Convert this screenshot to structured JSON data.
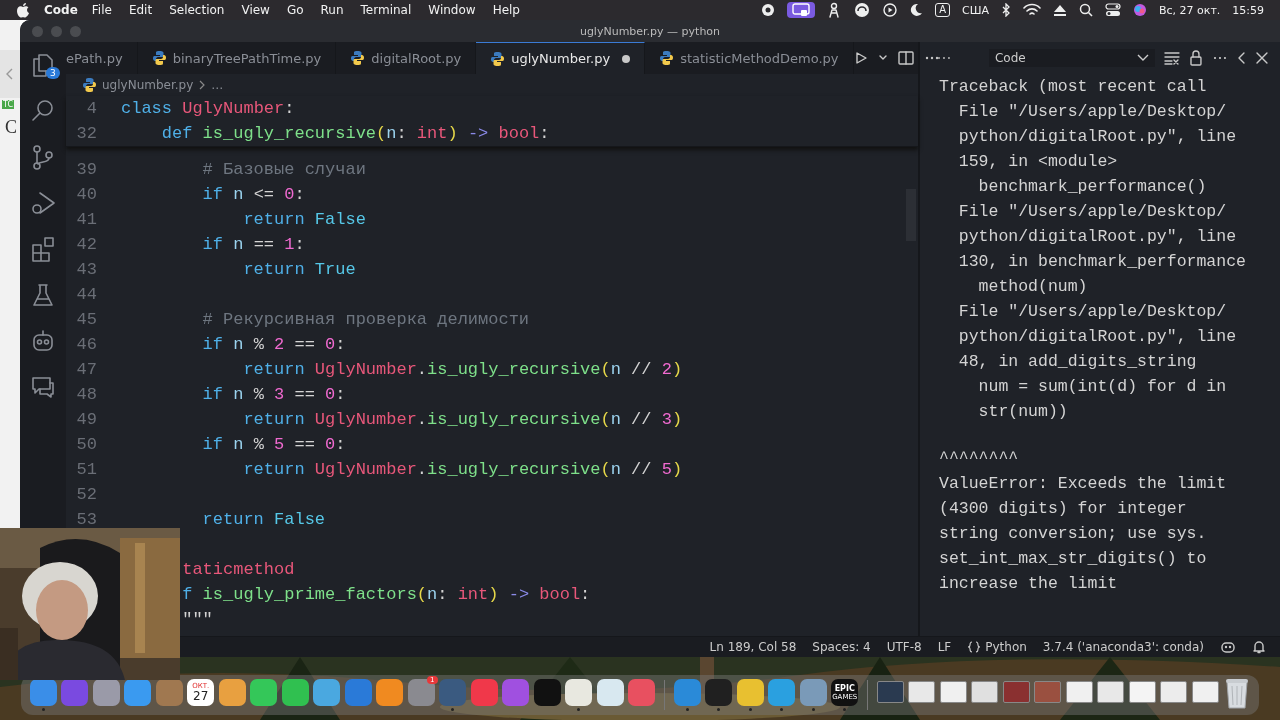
{
  "menu_bar": {
    "app_name": "Code",
    "items": [
      "File",
      "Edit",
      "Selection",
      "View",
      "Go",
      "Run",
      "Terminal",
      "Window",
      "Help"
    ],
    "input_source": "А",
    "keyboard_layout": "США",
    "date": "Вс, 27 окт.",
    "time": "15:59"
  },
  "background_window": {
    "tag": "TC",
    "letter": "C"
  },
  "window": {
    "title": "uglyNumber.py — python"
  },
  "activity_bar": {
    "explorer_badge": "3"
  },
  "tabs": [
    {
      "label": "ePath.py",
      "selected": false,
      "modified": false,
      "python_icon": false
    },
    {
      "label": "binaryTreePathTime.py",
      "selected": false,
      "modified": false,
      "python_icon": true
    },
    {
      "label": "digitalRoot.py",
      "selected": false,
      "modified": false,
      "python_icon": true
    },
    {
      "label": "uglyNumber.py",
      "selected": true,
      "modified": true,
      "python_icon": true
    },
    {
      "label": "statisticMethodDemo.py",
      "selected": false,
      "modified": false,
      "python_icon": true
    }
  ],
  "breadcrumbs": [
    "uglyNumber.py",
    "…"
  ],
  "sticky_lines": [
    {
      "number": "4",
      "tokens": [
        {
          "kind": "kw",
          "text": "class"
        },
        {
          "kind": "cls",
          "text": " UglyNumber"
        },
        {
          "kind": "op",
          "text": ":"
        }
      ]
    },
    {
      "number": "32",
      "tokens": [
        {
          "kind": "kw",
          "text": "    def"
        },
        {
          "kind": "fn",
          "text": " is_ugly_recursive"
        },
        {
          "kind": "paren",
          "text": "("
        },
        {
          "kind": "var",
          "text": "n"
        },
        {
          "kind": "op",
          "text": ":"
        },
        {
          "kind": "type",
          "text": " int"
        },
        {
          "kind": "paren",
          "text": ")"
        },
        {
          "kind": "arrow",
          "text": " ->"
        },
        {
          "kind": "type",
          "text": " bool"
        },
        {
          "kind": "op",
          "text": ":"
        }
      ]
    }
  ],
  "code_lines": [
    {
      "number": "39",
      "tokens": [
        {
          "kind": "cm",
          "text": "        # Базовые случаи"
        }
      ]
    },
    {
      "number": "40",
      "tokens": [
        {
          "kind": "kw",
          "text": "        if"
        },
        {
          "kind": "var",
          "text": " n"
        },
        {
          "kind": "op",
          "text": " <="
        },
        {
          "kind": "num",
          "text": " 0"
        },
        {
          "kind": "op",
          "text": ":"
        }
      ]
    },
    {
      "number": "41",
      "tokens": [
        {
          "kind": "kw",
          "text": "            return"
        },
        {
          "kind": "const",
          "text": " False"
        }
      ]
    },
    {
      "number": "42",
      "tokens": [
        {
          "kind": "kw",
          "text": "        if"
        },
        {
          "kind": "var",
          "text": " n"
        },
        {
          "kind": "op",
          "text": " =="
        },
        {
          "kind": "num",
          "text": " 1"
        },
        {
          "kind": "op",
          "text": ":"
        }
      ]
    },
    {
      "number": "43",
      "tokens": [
        {
          "kind": "kw",
          "text": "            return"
        },
        {
          "kind": "const",
          "text": " True"
        }
      ]
    },
    {
      "number": "44"
    },
    {
      "number": "45",
      "tokens": [
        {
          "kind": "cm",
          "text": "        # Рекурсивная проверка делимости"
        }
      ]
    },
    {
      "number": "46",
      "tokens": [
        {
          "kind": "kw",
          "text": "        if"
        },
        {
          "kind": "var",
          "text": " n"
        },
        {
          "kind": "op",
          "text": " %"
        },
        {
          "kind": "num",
          "text": " 2"
        },
        {
          "kind": "op",
          "text": " =="
        },
        {
          "kind": "num",
          "text": " 0"
        },
        {
          "kind": "op",
          "text": ":"
        }
      ]
    },
    {
      "number": "47",
      "tokens": [
        {
          "kind": "kw",
          "text": "            return"
        },
        {
          "kind": "cls",
          "text": " UglyNumber"
        },
        {
          "kind": "op",
          "text": "."
        },
        {
          "kind": "fn",
          "text": "is_ugly_recursive"
        },
        {
          "kind": "paren",
          "text": "("
        },
        {
          "kind": "var",
          "text": "n"
        },
        {
          "kind": "op",
          "text": " //"
        },
        {
          "kind": "num",
          "text": " 2"
        },
        {
          "kind": "paren",
          "text": ")"
        }
      ]
    },
    {
      "number": "48",
      "tokens": [
        {
          "kind": "kw",
          "text": "        if"
        },
        {
          "kind": "var",
          "text": " n"
        },
        {
          "kind": "op",
          "text": " %"
        },
        {
          "kind": "num",
          "text": " 3"
        },
        {
          "kind": "op",
          "text": " =="
        },
        {
          "kind": "num",
          "text": " 0"
        },
        {
          "kind": "op",
          "text": ":"
        }
      ]
    },
    {
      "number": "49",
      "tokens": [
        {
          "kind": "kw",
          "text": "            return"
        },
        {
          "kind": "cls",
          "text": " UglyNumber"
        },
        {
          "kind": "op",
          "text": "."
        },
        {
          "kind": "fn",
          "text": "is_ugly_recursive"
        },
        {
          "kind": "paren",
          "text": "("
        },
        {
          "kind": "var",
          "text": "n"
        },
        {
          "kind": "op",
          "text": " //"
        },
        {
          "kind": "num",
          "text": " 3"
        },
        {
          "kind": "paren",
          "text": ")"
        }
      ]
    },
    {
      "number": "50",
      "tokens": [
        {
          "kind": "kw",
          "text": "        if"
        },
        {
          "kind": "var",
          "text": " n"
        },
        {
          "kind": "op",
          "text": " %"
        },
        {
          "kind": "num",
          "text": " 5"
        },
        {
          "kind": "op",
          "text": " =="
        },
        {
          "kind": "num",
          "text": " 0"
        },
        {
          "kind": "op",
          "text": ":"
        }
      ]
    },
    {
      "number": "51",
      "tokens": [
        {
          "kind": "kw",
          "text": "            return"
        },
        {
          "kind": "cls",
          "text": " UglyNumber"
        },
        {
          "kind": "op",
          "text": "."
        },
        {
          "kind": "fn",
          "text": "is_ugly_recursive"
        },
        {
          "kind": "paren",
          "text": "("
        },
        {
          "kind": "var",
          "text": "n"
        },
        {
          "kind": "op",
          "text": " //"
        },
        {
          "kind": "num",
          "text": " 5"
        },
        {
          "kind": "paren",
          "text": ")"
        }
      ]
    },
    {
      "number": "52"
    },
    {
      "number": "53",
      "tokens": [
        {
          "kind": "kw",
          "text": "        return"
        },
        {
          "kind": "const",
          "text": " False"
        }
      ]
    },
    {
      "tokens": [
        {
          "kind": "dec",
          "text": "      taticmethod"
        }
      ]
    },
    {
      "tokens": [
        {
          "kind": "kw",
          "text": "      f"
        },
        {
          "kind": "fn",
          "text": " is_ugly_prime_factors"
        },
        {
          "kind": "paren",
          "text": "("
        },
        {
          "kind": "var",
          "text": "n"
        },
        {
          "kind": "op",
          "text": ":"
        },
        {
          "kind": "type",
          "text": " int"
        },
        {
          "kind": "paren",
          "text": ")"
        },
        {
          "kind": "arrow",
          "text": " ->"
        },
        {
          "kind": "type",
          "text": " bool"
        },
        {
          "kind": "op",
          "text": ":"
        }
      ]
    },
    {
      "tokens": [
        {
          "kind": "str",
          "text": "      \"\"\""
        }
      ]
    }
  ],
  "output": {
    "channel": "Code",
    "blocks": [
      [
        "Traceback (most recent call",
        "  File \"/Users/apple/Desktop/",
        "  python/digitalRoot.py\", line",
        "  159, in <module>",
        "    benchmark_performance()",
        "  File \"/Users/apple/Desktop/",
        "  python/digitalRoot.py\", line",
        "  130, in benchmark_performance",
        "    method(num)",
        "  File \"/Users/apple/Desktop/",
        "  python/digitalRoot.py\", line",
        "  48, in add_digits_string",
        "    num = sum(int(d) for d in",
        "    str(num))"
      ],
      [
        "^^^^^^^^",
        "ValueError: Exceeds the limit",
        "(4300 digits) for integer",
        "string conversion; use sys.",
        "set_int_max_str_digits() to",
        "increase the limit"
      ]
    ]
  },
  "status_bar": {
    "position": "Ln 189, Col 58",
    "indentation": "Spaces: 4",
    "encoding": "UTF-8",
    "line_ending": "LF",
    "language": "Python",
    "interpreter": "3.7.4 ('anaconda3': conda)"
  },
  "dock": {
    "items": [
      {
        "kind": "app",
        "color": "#3a8ee8",
        "running": true
      },
      {
        "kind": "app",
        "color": "#7a4ae0",
        "running": false
      },
      {
        "kind": "app",
        "color": "#9a9aa8",
        "running": false
      },
      {
        "kind": "app",
        "color": "#3a9af0",
        "running": false
      },
      {
        "kind": "app",
        "color": "#a07850",
        "running": false
      },
      {
        "kind": "calendar",
        "month": "ОКТ.",
        "label": "27",
        "running": false
      },
      {
        "kind": "app",
        "color": "#e8a040",
        "running": false
      },
      {
        "kind": "app",
        "color": "#34c759",
        "running": false
      },
      {
        "kind": "app",
        "color": "#30c050",
        "running": false
      },
      {
        "kind": "app",
        "color": "#4aa8e0",
        "running": false
      },
      {
        "kind": "app",
        "color": "#2a7ad8",
        "running": false
      },
      {
        "kind": "app",
        "color": "#f08a20",
        "running": false
      },
      {
        "kind": "app",
        "color": "#8a8a90",
        "running": false,
        "badge": "1"
      },
      {
        "kind": "app",
        "color": "#3a5a80",
        "running": true
      },
      {
        "kind": "app",
        "color": "#f0384a",
        "running": false
      },
      {
        "kind": "app",
        "color": "#a050e0",
        "running": false
      },
      {
        "kind": "app",
        "color": "#111111",
        "running": false
      },
      {
        "kind": "app",
        "color": "#e8e8e0",
        "running": true
      },
      {
        "kind": "app",
        "color": "#d8e8f0",
        "running": false
      },
      {
        "kind": "app",
        "color": "#e85060",
        "running": false
      },
      {
        "kind": "separator"
      },
      {
        "kind": "app",
        "color": "#2a8ad8",
        "running": true
      },
      {
        "kind": "app",
        "color": "#202020",
        "running": true
      },
      {
        "kind": "app",
        "color": "#e8c030",
        "running": true
      },
      {
        "kind": "app",
        "color": "#2aa0e0",
        "running": true
      },
      {
        "kind": "app",
        "color": "#7a9ab8",
        "running": true
      },
      {
        "kind": "epic",
        "lines": [
          "EPIC",
          "GAMES"
        ],
        "running": true
      },
      {
        "kind": "separator"
      },
      {
        "kind": "window",
        "color": "#2a3a50",
        "running": false
      },
      {
        "kind": "window",
        "color": "#e8e8e8",
        "running": false
      },
      {
        "kind": "window",
        "color": "#f0f0f0",
        "running": false
      },
      {
        "kind": "window",
        "color": "#e0e0e0",
        "running": false
      },
      {
        "kind": "window",
        "color": "#8a3030",
        "running": false
      },
      {
        "kind": "window",
        "color": "#9a5040",
        "running": false
      },
      {
        "kind": "window",
        "color": "#f0f0f0",
        "running": false
      },
      {
        "kind": "window",
        "color": "#e8e8e8",
        "running": false
      },
      {
        "kind": "window",
        "color": "#f4f4f4",
        "running": false
      },
      {
        "kind": "window",
        "color": "#ececec",
        "running": false
      },
      {
        "kind": "window",
        "color": "#f0f0f0",
        "running": false
      },
      {
        "kind": "trash",
        "running": false
      }
    ]
  }
}
